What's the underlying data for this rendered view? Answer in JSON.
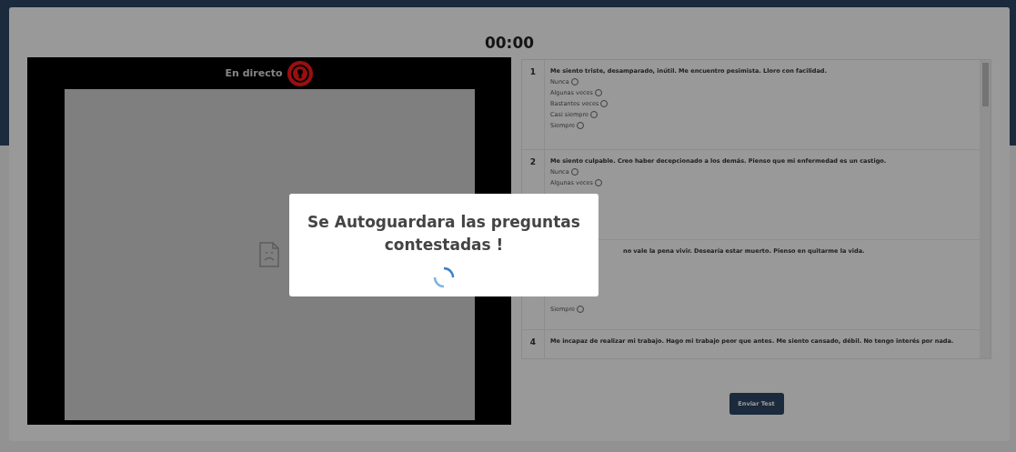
{
  "timer": "00:00",
  "video": {
    "live_label": "En directo"
  },
  "questions": [
    {
      "kind": "normal",
      "number": "1",
      "title": "Me siento triste, desamparado, inútil. Me encuentro pesimista. Lloro con facilidad.",
      "options": [
        {
          "label": "Nunca",
          "selected": false
        },
        {
          "label": "Algunas veces",
          "selected": false
        },
        {
          "label": "Bastantes veces",
          "selected": false
        },
        {
          "label": "Casi siempre",
          "selected": false
        },
        {
          "label": "Siempre",
          "selected": false
        }
      ]
    },
    {
      "kind": "normal",
      "number": "2",
      "title": "Me siento culpable. Creo haber decepcionado a los demás. Pienso que mi enfermedad es un castigo.",
      "options": [
        {
          "label": "Nunca",
          "selected": false
        },
        {
          "label": "Algunas veces",
          "selected": false
        }
      ]
    },
    {
      "kind": "covered",
      "title": "no vale la pena vivir. Desearía estar muerto. Pienso en quitarme la vida.",
      "options": [
        {
          "label": "Siempre",
          "selected": false
        }
      ]
    },
    {
      "kind": "normal",
      "number": "4",
      "title": "Me incapaz de realizar mi trabajo. Hago mi trabajo peor que antes. Me siento cansado, débil. No tengo interés por nada."
    }
  ],
  "submit_button": "Enviar Test",
  "modal": {
    "title": "Se Autoguardara las preguntas contestadas !"
  }
}
